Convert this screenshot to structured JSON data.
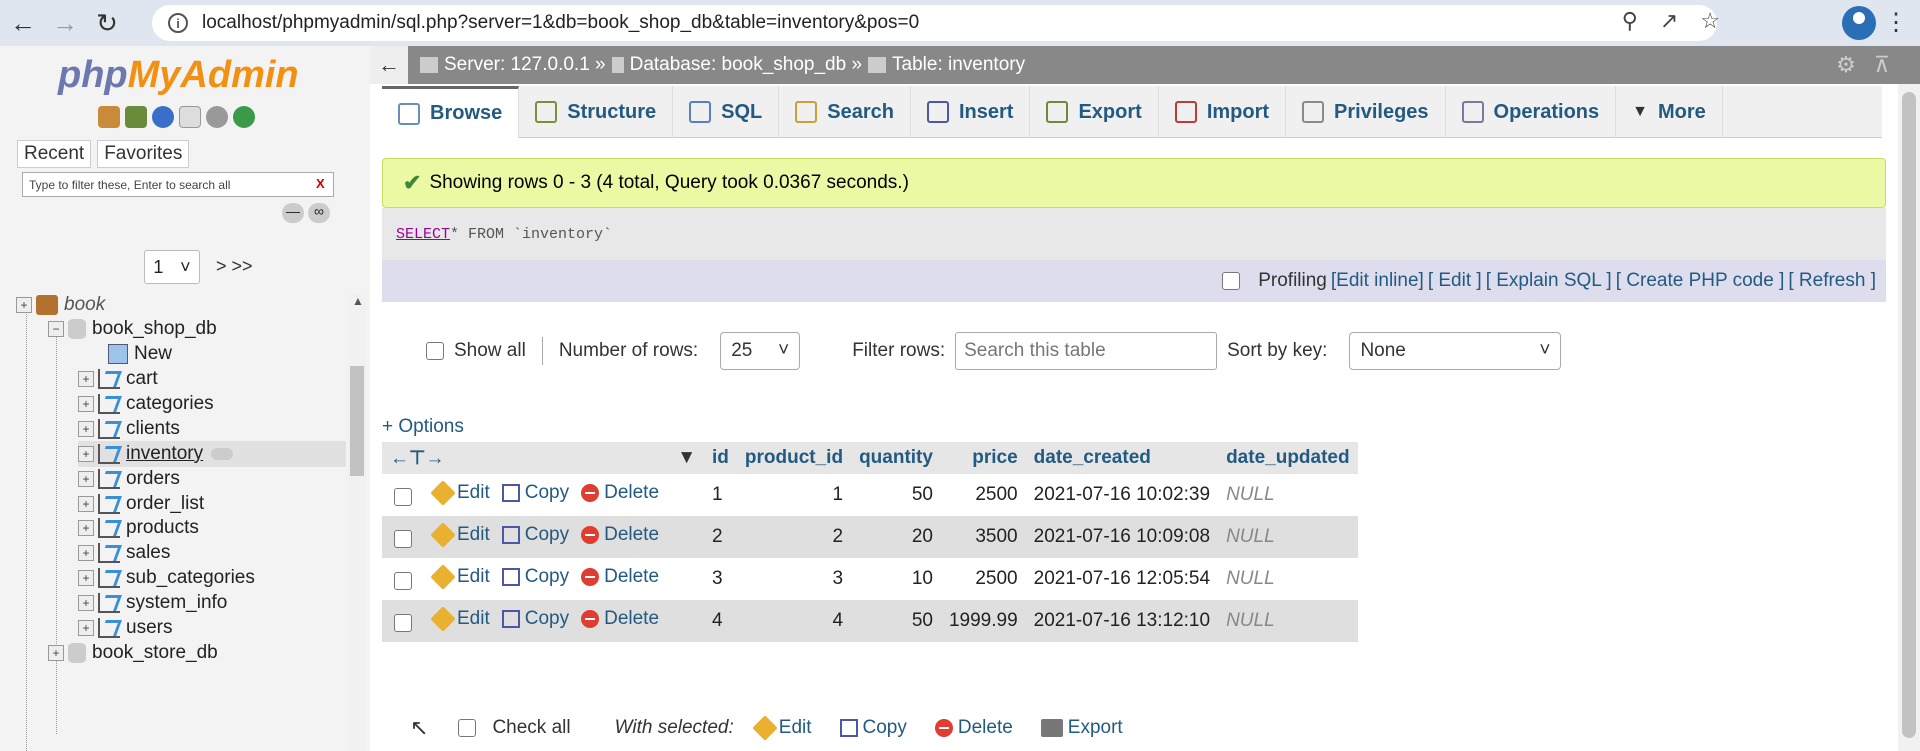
{
  "browser": {
    "url": "localhost/phpmyadmin/sql.php?server=1&db=book_shop_db&table=inventory&pos=0"
  },
  "sidebar": {
    "logo_php": "php",
    "logo_myadmin": "MyAdmin",
    "recent_label": "Recent",
    "favorites_label": "Favorites",
    "filter_placeholder": "Type to filter these, Enter to search all",
    "filter_clear": "X",
    "page_value": "1",
    "page_nav": "> >>",
    "tree": {
      "root": "book",
      "db": "book_shop_db",
      "new": "New",
      "tables": [
        "cart",
        "categories",
        "clients",
        "inventory",
        "orders",
        "order_list",
        "products",
        "sales",
        "sub_categories",
        "system_info",
        "users"
      ],
      "next_db": "book_store_db"
    }
  },
  "main": {
    "breadcrumb": {
      "server": "Server: 127.0.0.1 »",
      "database": "Database: book_shop_db »",
      "table": "Table: inventory"
    },
    "tabs": [
      "Browse",
      "Structure",
      "SQL",
      "Search",
      "Insert",
      "Export",
      "Import",
      "Privileges",
      "Operations",
      "More"
    ],
    "success_message": "Showing rows 0 - 3 (4 total, Query took 0.0367 seconds.)",
    "sql_keyword": "SELECT",
    "sql_rest": " * FROM `inventory`",
    "profiling": "Profiling",
    "profiling_links": {
      "edit_inline": "[Edit inline]",
      "edit": "[ Edit ]",
      "explain": "[ Explain SQL ]",
      "create_php": "[ Create PHP code ]",
      "refresh": "[ Refresh ]"
    },
    "controls": {
      "show_all": "Show all",
      "num_rows_label": "Number of rows:",
      "num_rows_value": "25",
      "filter_label": "Filter rows:",
      "filter_placeholder": "Search this table",
      "sort_label": "Sort by key:",
      "sort_value": "None"
    },
    "options_label": "+ Options",
    "table": {
      "columns": [
        "id",
        "product_id",
        "quantity",
        "price",
        "date_created",
        "date_updated"
      ],
      "action_labels": {
        "edit": "Edit",
        "copy": "Copy",
        "delete": "Delete"
      },
      "rows": [
        {
          "id": "1",
          "product_id": "1",
          "quantity": "50",
          "price": "2500",
          "date_created": "2021-07-16 10:02:39",
          "date_updated": "NULL"
        },
        {
          "id": "2",
          "product_id": "2",
          "quantity": "20",
          "price": "3500",
          "date_created": "2021-07-16 10:09:08",
          "date_updated": "NULL"
        },
        {
          "id": "3",
          "product_id": "3",
          "quantity": "10",
          "price": "2500",
          "date_created": "2021-07-16 12:05:54",
          "date_updated": "NULL"
        },
        {
          "id": "4",
          "product_id": "4",
          "quantity": "50",
          "price": "1999.99",
          "date_created": "2021-07-16 13:12:10",
          "date_updated": "NULL"
        }
      ]
    },
    "bulk": {
      "check_all": "Check all",
      "with_selected": "With selected:",
      "edit": "Edit",
      "copy": "Copy",
      "delete": "Delete",
      "export": "Export"
    }
  }
}
